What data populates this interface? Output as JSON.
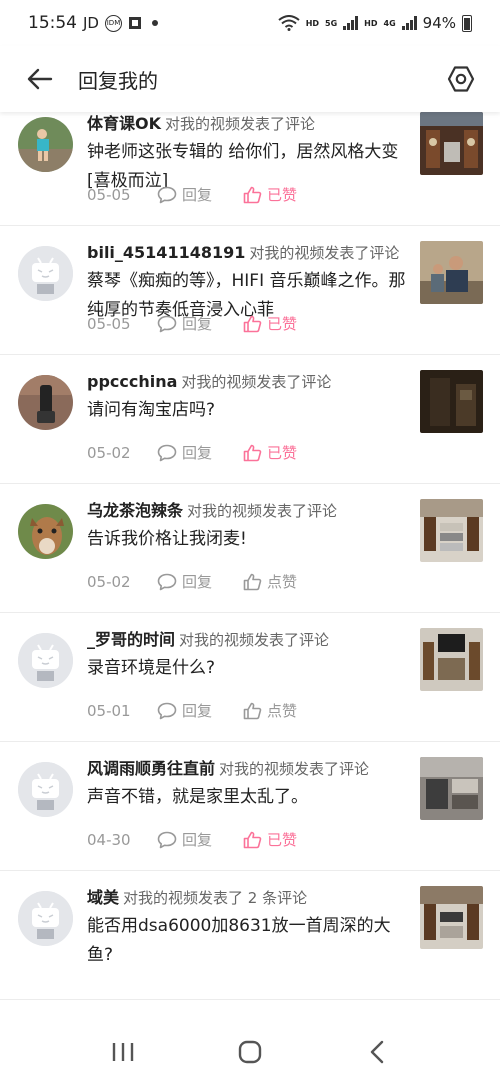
{
  "status_bar": {
    "time": "15:54",
    "carrier": "JD",
    "hd1": "HD",
    "hd2": "HD",
    "net1": "5G",
    "net2": "4G",
    "battery": "94%"
  },
  "header": {
    "title": "回复我的"
  },
  "items": [
    {
      "username": "体育课OK",
      "action": "对我的视频发表了评论",
      "comment": "钟老师这张专辑的 给你们，居然风格大变[喜极而泣]",
      "date": "05-05",
      "reply_label": "回复",
      "like_label": "已赞",
      "liked": true,
      "avatar": "photo"
    },
    {
      "username": "bili_45141148191",
      "action": "对我的视频发表了评论",
      "comment": "蔡琴《痴痴的等》，HIFI 音乐巅峰之作。那纯厚的节奏低音浸入心菲",
      "date": "05-05",
      "reply_label": "回复",
      "like_label": "已赞",
      "liked": true,
      "avatar": "default"
    },
    {
      "username": "ppccchina",
      "action": "对我的视频发表了评论",
      "comment": "请问有淘宝店吗?",
      "date": "05-02",
      "reply_label": "回复",
      "like_label": "已赞",
      "liked": true,
      "avatar": "photo"
    },
    {
      "username": "乌龙茶泡辣条",
      "action": "对我的视频发表了评论",
      "comment": "告诉我价格让我闭麦!",
      "date": "05-02",
      "reply_label": "回复",
      "like_label": "点赞",
      "liked": false,
      "avatar": "photo"
    },
    {
      "username": "_罗哥的时间",
      "action": "对我的视频发表了评论",
      "comment": "录音环境是什么?",
      "date": "05-01",
      "reply_label": "回复",
      "like_label": "点赞",
      "liked": false,
      "avatar": "default"
    },
    {
      "username": "风调雨顺勇往直前",
      "action": "对我的视频发表了评论",
      "comment": "声音不错，就是家里太乱了。",
      "date": "04-30",
      "reply_label": "回复",
      "like_label": "已赞",
      "liked": true,
      "avatar": "default"
    },
    {
      "username": "域美",
      "action": "对我的视频发表了 2 条评论",
      "comment": "能否用dsa6000加8631放一首周深的大鱼?",
      "date": "",
      "reply_label": "",
      "like_label": "",
      "liked": false,
      "avatar": "default"
    }
  ],
  "colors": {
    "accent_pink": "#fb7299",
    "muted": "#999999",
    "divider": "#ececec"
  },
  "icons": {
    "back": "arrow-left-icon",
    "settings": "hexagon-settings-icon",
    "reply": "speech-bubble-icon",
    "like": "thumbs-up-icon",
    "nav_recent": "recent-apps-icon",
    "nav_home": "home-icon",
    "nav_back": "back-chevron-icon"
  }
}
